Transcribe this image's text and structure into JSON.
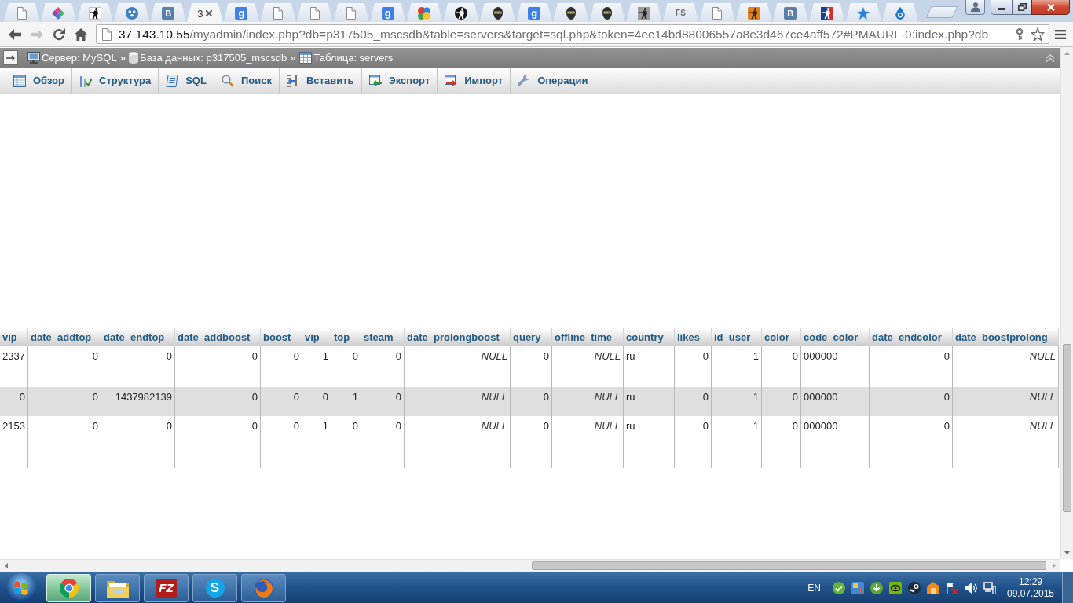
{
  "browser": {
    "tabs": [
      {
        "kind": "page",
        "selected": false
      },
      {
        "kind": "diamond",
        "selected": false
      },
      {
        "kind": "soldier",
        "selected": false
      },
      {
        "kind": "dots",
        "selected": false
      },
      {
        "kind": "vk",
        "glyph": "B",
        "selected": false
      },
      {
        "title": "3",
        "selected": true
      },
      {
        "kind": "google",
        "glyph": "g",
        "selected": false
      },
      {
        "kind": "page",
        "selected": false
      },
      {
        "kind": "page",
        "selected": false
      },
      {
        "kind": "page",
        "selected": false
      },
      {
        "kind": "google",
        "glyph": "g",
        "selected": false
      },
      {
        "kind": "splash",
        "selected": false
      },
      {
        "kind": "soldier-circle",
        "selected": false
      },
      {
        "kind": "masked",
        "selected": false
      },
      {
        "kind": "google",
        "glyph": "g",
        "selected": false
      },
      {
        "kind": "masked",
        "selected": false
      },
      {
        "kind": "masked",
        "selected": false
      },
      {
        "kind": "soldier-grey",
        "selected": false
      },
      {
        "kind": "fs",
        "glyph": "FS",
        "selected": false
      },
      {
        "kind": "page",
        "selected": false
      },
      {
        "kind": "soldier-orange",
        "selected": false
      },
      {
        "kind": "vk",
        "glyph": "B",
        "selected": false
      },
      {
        "kind": "sport",
        "selected": false
      },
      {
        "kind": "star",
        "selected": false
      },
      {
        "kind": "drop",
        "selected": false
      }
    ],
    "nav_buttons": [
      {
        "kind": "back",
        "disabled": false
      },
      {
        "kind": "forward",
        "disabled": true
      },
      {
        "kind": "reload",
        "disabled": false
      },
      {
        "kind": "home",
        "disabled": false
      }
    ],
    "address_bar": {
      "host": "37.143.10.55",
      "path": "/myadmin/index.php?db=p317505_mscsdb&table=servers&target=sql.php&token=4ee14bd88006557a8e3d467ce4aff572#PMAURL-0:index.php?db"
    }
  },
  "phpmyadmin": {
    "breadcrumb": [
      {
        "kind": "server",
        "label": "Сервер: MySQL",
        "separator": "»"
      },
      {
        "kind": "database",
        "label": "База данных: p317505_mscsdb",
        "separator": "»"
      },
      {
        "kind": "table",
        "label": "Таблица: servers"
      }
    ],
    "menu": [
      {
        "kind": "browse",
        "label": "Обзор",
        "selected": false
      },
      {
        "kind": "structure",
        "label": "Структура",
        "selected": false
      },
      {
        "kind": "sql",
        "label": "SQL",
        "selected": false
      },
      {
        "kind": "search",
        "label": "Поиск",
        "selected": false
      },
      {
        "kind": "insert",
        "label": "Вставить",
        "selected": false
      },
      {
        "kind": "export",
        "label": "Экспорт",
        "selected": false
      },
      {
        "kind": "import",
        "label": "Импорт",
        "selected": false
      },
      {
        "kind": "operations",
        "label": "Операции",
        "selected": false
      }
    ],
    "table": {
      "columns": [
        "vip",
        "date_addtop",
        "date_endtop",
        "date_addboost",
        "boost",
        "vip",
        "top",
        "steam",
        "date_prolongboost",
        "query",
        "offline_time",
        "country",
        "likes",
        "id_user",
        "color",
        "code_color",
        "date_endcolor",
        "date_boostprolong"
      ],
      "rows": [
        {
          "cells": [
            {
              "kind": "number",
              "text": "2337"
            },
            {
              "kind": "number",
              "text": "0"
            },
            {
              "kind": "number",
              "text": "0"
            },
            {
              "kind": "number",
              "text": "0"
            },
            {
              "kind": "number",
              "text": "0"
            },
            {
              "kind": "number",
              "text": "1"
            },
            {
              "kind": "number",
              "text": "0"
            },
            {
              "kind": "number",
              "text": "0"
            },
            {
              "kind": "null",
              "text": "NULL"
            },
            {
              "kind": "number",
              "text": "0"
            },
            {
              "kind": "null",
              "text": "NULL"
            },
            {
              "kind": "text",
              "text": "ru"
            },
            {
              "kind": "number",
              "text": "0"
            },
            {
              "kind": "number",
              "text": "1"
            },
            {
              "kind": "number",
              "text": "0"
            },
            {
              "kind": "text",
              "text": "000000"
            },
            {
              "kind": "number",
              "text": "0"
            },
            {
              "kind": "null",
              "text": "NULL"
            }
          ]
        },
        {
          "cells": [
            {
              "kind": "number",
              "text": "0"
            },
            {
              "kind": "number",
              "text": "0"
            },
            {
              "kind": "number",
              "text": "1437982139"
            },
            {
              "kind": "number",
              "text": "0"
            },
            {
              "kind": "number",
              "text": "0"
            },
            {
              "kind": "number",
              "text": "0"
            },
            {
              "kind": "number",
              "text": "1"
            },
            {
              "kind": "number",
              "text": "0"
            },
            {
              "kind": "null",
              "text": "NULL"
            },
            {
              "kind": "number",
              "text": "0"
            },
            {
              "kind": "null",
              "text": "NULL"
            },
            {
              "kind": "text",
              "text": "ru"
            },
            {
              "kind": "number",
              "text": "0"
            },
            {
              "kind": "number",
              "text": "1"
            },
            {
              "kind": "number",
              "text": "0"
            },
            {
              "kind": "text",
              "text": "000000"
            },
            {
              "kind": "number",
              "text": "0"
            },
            {
              "kind": "null",
              "text": "NULL"
            }
          ]
        },
        {
          "cells": [
            {
              "kind": "number",
              "text": "2153"
            },
            {
              "kind": "number",
              "text": "0"
            },
            {
              "kind": "number",
              "text": "0"
            },
            {
              "kind": "number",
              "text": "0"
            },
            {
              "kind": "number",
              "text": "0"
            },
            {
              "kind": "number",
              "text": "1"
            },
            {
              "kind": "number",
              "text": "0"
            },
            {
              "kind": "number",
              "text": "0"
            },
            {
              "kind": "null",
              "text": "NULL"
            },
            {
              "kind": "number",
              "text": "0"
            },
            {
              "kind": "null",
              "text": "NULL"
            },
            {
              "kind": "text",
              "text": "ru"
            },
            {
              "kind": "number",
              "text": "0"
            },
            {
              "kind": "number",
              "text": "1"
            },
            {
              "kind": "number",
              "text": "0"
            },
            {
              "kind": "text",
              "text": "000000"
            },
            {
              "kind": "number",
              "text": "0"
            },
            {
              "kind": "null",
              "text": "NULL"
            }
          ]
        }
      ]
    }
  },
  "taskbar": {
    "apps": [
      {
        "kind": "chrome",
        "active": true
      },
      {
        "kind": "folder",
        "active": false
      },
      {
        "kind": "filezilla",
        "glyph": "FZ",
        "active": false
      },
      {
        "kind": "skype",
        "glyph": "S",
        "active": false
      },
      {
        "kind": "firefox",
        "active": false
      }
    ],
    "language": "EN",
    "clock": {
      "time": "12:29",
      "date": "09.07.2015"
    }
  }
}
